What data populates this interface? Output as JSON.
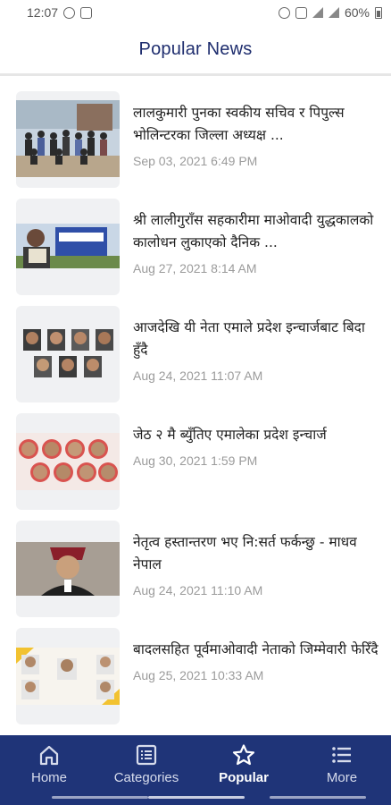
{
  "status_bar": {
    "time": "12:07",
    "battery": "60%"
  },
  "header": {
    "title": "Popular News"
  },
  "news": [
    {
      "headline": "लालकुमारी पुनका स्वकीय सचिव र पिपुल्स भोलिन्टरका जिल्ला अध्यक्ष ...",
      "date": "Sep 03, 2021 6:49 PM"
    },
    {
      "headline": "श्री लालीगुराँस सहकारीमा माओवादी युद्धकालको कालोधन लुकाएको दैनिक ...",
      "date": "Aug 27, 2021 8:14 AM"
    },
    {
      "headline": "आजदेखि यी नेता एमाले प्रदेश इन्चार्जबाट बिदा हुँदै",
      "date": "Aug 24, 2021 11:07 AM"
    },
    {
      "headline": "जेठ २ मै ब्युँतिए एमालेका प्रदेश इन्चार्ज",
      "date": "Aug 30, 2021 1:59 PM"
    },
    {
      "headline": "नेतृत्व हस्तान्तरण भए नि:सर्त फर्कन्छु - माधव नेपाल",
      "date": "Aug 24, 2021 11:10 AM"
    },
    {
      "headline": "बादलसहित पूर्वमाओवादी नेताको जिम्मेवारी फेरिँदै",
      "date": "Aug 25, 2021 10:33 AM"
    }
  ],
  "bottom_nav": {
    "items": [
      {
        "label": "Home",
        "icon": "home-icon"
      },
      {
        "label": "Categories",
        "icon": "categories-icon"
      },
      {
        "label": "Popular",
        "icon": "star-icon"
      },
      {
        "label": "More",
        "icon": "menu-icon"
      }
    ],
    "active": "Popular"
  },
  "colors": {
    "header_title": "#1e2d6e",
    "nav_background": "#1f3478",
    "date_text": "#9b9b9b"
  }
}
